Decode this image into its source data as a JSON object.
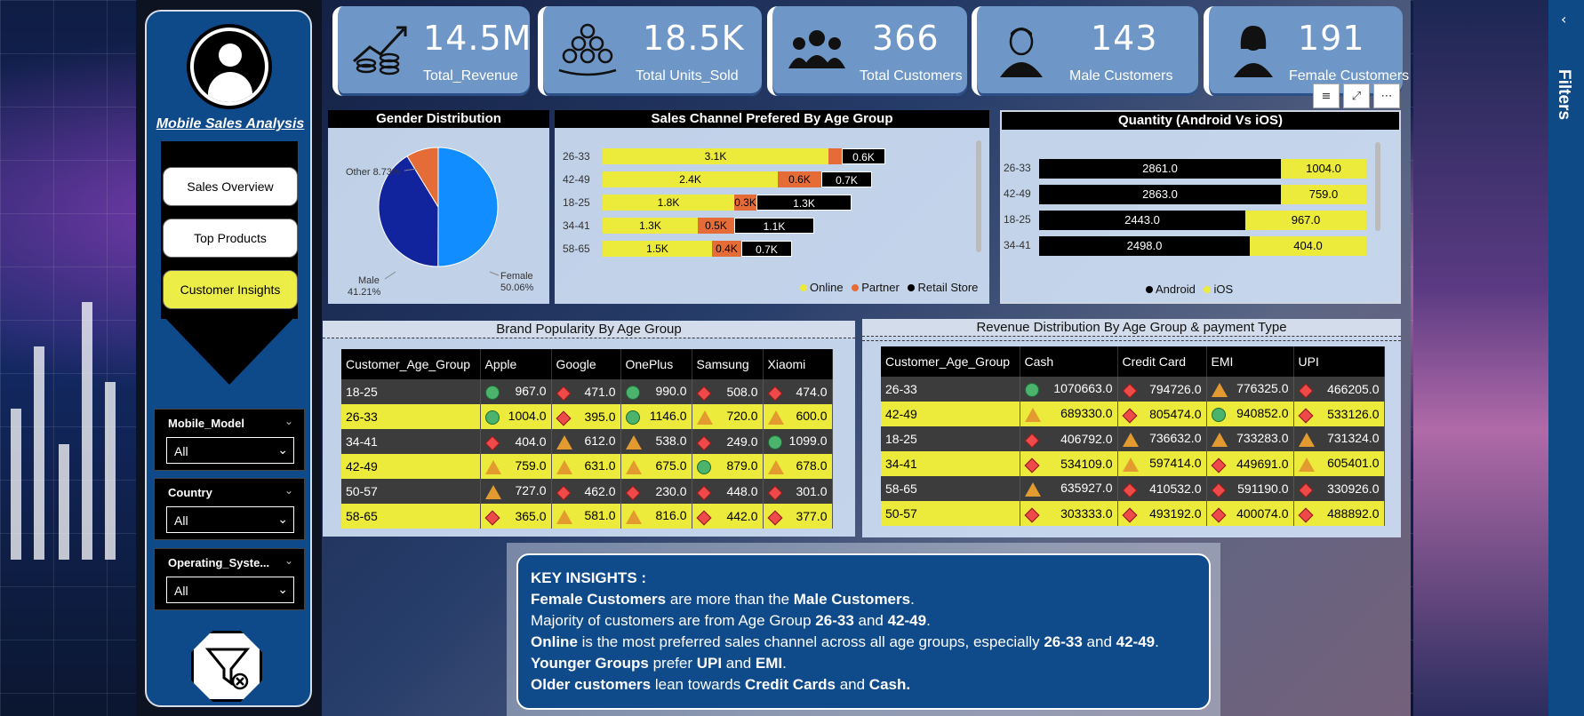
{
  "sidebar": {
    "title": "Mobile Sales Analysis",
    "nav": [
      {
        "label": "Sales Overview",
        "active": false
      },
      {
        "label": "Top Products",
        "active": false
      },
      {
        "label": "Customer Insights",
        "active": true
      }
    ],
    "slicers": [
      {
        "title": "Mobile_Model",
        "value": "All"
      },
      {
        "title": "Country",
        "value": "All"
      },
      {
        "title": "Operating_Syste...",
        "value": "All"
      }
    ]
  },
  "kpis": [
    {
      "value": "14.5M",
      "label": "Total_Revenue",
      "icon": "revenue-chart-icon"
    },
    {
      "value": "18.5K",
      "label": "Total Units_Sold",
      "icon": "coins-stack-icon"
    },
    {
      "value": "366",
      "label": "Total Customers",
      "icon": "customers-group-icon"
    },
    {
      "value": "143",
      "label": "Male Customers",
      "icon": "male-user-icon"
    },
    {
      "value": "191",
      "label": "Female Customers",
      "icon": "female-user-icon"
    }
  ],
  "gender": {
    "title": "Gender Distribution",
    "slices": [
      {
        "name": "Female",
        "pct": "50.06%",
        "value": 50.06,
        "color": "#118dff"
      },
      {
        "name": "Male",
        "pct": "41.21%",
        "value": 41.21,
        "color": "#12239e"
      },
      {
        "name": "Other",
        "pct": "8.73%",
        "value": 8.73,
        "color": "#e66c37"
      }
    ]
  },
  "channel": {
    "title": "Sales Channel Prefered By Age Group",
    "legend": [
      "Online",
      "Partner",
      "Retail Store"
    ],
    "colors": [
      "#ecea3a",
      "#e66c37",
      "#000000"
    ],
    "rows": [
      {
        "age": "26-33",
        "labels": [
          "3.1K",
          "",
          "0.6K"
        ],
        "values": [
          3.1,
          0.18,
          0.6
        ]
      },
      {
        "age": "42-49",
        "labels": [
          "2.4K",
          "0.6K",
          "0.7K"
        ],
        "values": [
          2.4,
          0.6,
          0.7
        ]
      },
      {
        "age": "18-25",
        "labels": [
          "1.8K",
          "0.3K",
          "1.3K"
        ],
        "values": [
          1.8,
          0.3,
          1.3
        ]
      },
      {
        "age": "34-41",
        "labels": [
          "1.3K",
          "0.5K",
          "1.1K"
        ],
        "values": [
          1.3,
          0.5,
          1.1
        ]
      },
      {
        "age": "58-65",
        "labels": [
          "1.5K",
          "0.4K",
          "0.7K"
        ],
        "values": [
          1.5,
          0.4,
          0.7
        ]
      }
    ]
  },
  "quantity": {
    "title": "Quantity (Android Vs iOS)",
    "legend": [
      "Android",
      "iOS"
    ],
    "rows": [
      {
        "age": "26-33",
        "android": "2861.0",
        "ios": "1004.0"
      },
      {
        "age": "42-49",
        "android": "2863.0",
        "ios": "759.0"
      },
      {
        "age": "18-25",
        "android": "2443.0",
        "ios": "967.0"
      },
      {
        "age": "34-41",
        "android": "2498.0",
        "ios": "404.0"
      }
    ]
  },
  "brand": {
    "title": "Brand Popularity By Age Group",
    "headers": [
      "Customer_Age_Group",
      "Apple",
      "Google",
      "OnePlus",
      "Samsung",
      "Xiaomi"
    ],
    "rows": [
      {
        "age": "18-25",
        "cells": [
          [
            "circle",
            "967.0"
          ],
          [
            "diamond",
            "471.0"
          ],
          [
            "circle",
            "990.0"
          ],
          [
            "diamond",
            "508.0"
          ],
          [
            "diamond",
            "474.0"
          ]
        ]
      },
      {
        "age": "26-33",
        "cells": [
          [
            "circle",
            "1004.0"
          ],
          [
            "diamond",
            "395.0"
          ],
          [
            "circle",
            "1146.0"
          ],
          [
            "triangle",
            "720.0"
          ],
          [
            "triangle",
            "600.0"
          ]
        ]
      },
      {
        "age": "34-41",
        "cells": [
          [
            "diamond",
            "404.0"
          ],
          [
            "triangle",
            "612.0"
          ],
          [
            "triangle",
            "538.0"
          ],
          [
            "diamond",
            "249.0"
          ],
          [
            "circle",
            "1099.0"
          ]
        ]
      },
      {
        "age": "42-49",
        "cells": [
          [
            "triangle",
            "759.0"
          ],
          [
            "triangle",
            "631.0"
          ],
          [
            "triangle",
            "675.0"
          ],
          [
            "circle",
            "879.0"
          ],
          [
            "triangle",
            "678.0"
          ]
        ]
      },
      {
        "age": "50-57",
        "cells": [
          [
            "triangle",
            "727.0"
          ],
          [
            "diamond",
            "462.0"
          ],
          [
            "diamond",
            "230.0"
          ],
          [
            "diamond",
            "448.0"
          ],
          [
            "diamond",
            "301.0"
          ]
        ]
      },
      {
        "age": "58-65",
        "cells": [
          [
            "diamond",
            "365.0"
          ],
          [
            "triangle",
            "581.0"
          ],
          [
            "triangle",
            "816.0"
          ],
          [
            "diamond",
            "442.0"
          ],
          [
            "diamond",
            "377.0"
          ]
        ]
      }
    ]
  },
  "revenue": {
    "title": "Revenue Distribution By Age Group & payment Type",
    "headers": [
      "Customer_Age_Group",
      "Cash",
      "Credit Card",
      "EMI",
      "UPI"
    ],
    "rows": [
      {
        "age": "26-33",
        "cells": [
          [
            "circle",
            "1070663.0"
          ],
          [
            "diamond",
            "794726.0"
          ],
          [
            "triangle",
            "776325.0"
          ],
          [
            "diamond",
            "466205.0"
          ]
        ]
      },
      {
        "age": "42-49",
        "cells": [
          [
            "triangle",
            "689330.0"
          ],
          [
            "diamond",
            "805474.0"
          ],
          [
            "circle",
            "940852.0"
          ],
          [
            "diamond",
            "533126.0"
          ]
        ]
      },
      {
        "age": "18-25",
        "cells": [
          [
            "diamond",
            "406792.0"
          ],
          [
            "triangle",
            "736632.0"
          ],
          [
            "triangle",
            "733283.0"
          ],
          [
            "triangle",
            "731324.0"
          ]
        ]
      },
      {
        "age": "34-41",
        "cells": [
          [
            "diamond",
            "534109.0"
          ],
          [
            "triangle",
            "597414.0"
          ],
          [
            "diamond",
            "449691.0"
          ],
          [
            "triangle",
            "605401.0"
          ]
        ]
      },
      {
        "age": "58-65",
        "cells": [
          [
            "triangle",
            "635927.0"
          ],
          [
            "diamond",
            "410532.0"
          ],
          [
            "diamond",
            "591190.0"
          ],
          [
            "diamond",
            "330926.0"
          ]
        ]
      },
      {
        "age": "50-57",
        "cells": [
          [
            "diamond",
            "303333.0"
          ],
          [
            "diamond",
            "493192.0"
          ],
          [
            "diamond",
            "400074.0"
          ],
          [
            "diamond",
            "488892.0"
          ]
        ]
      }
    ]
  },
  "insights": {
    "heading": "KEY INSIGHTS :",
    "lines": [
      [
        [
          "b",
          "Female Customers"
        ],
        [
          "t",
          " are more than the "
        ],
        [
          "b",
          "Male Customers"
        ],
        [
          "t",
          "."
        ]
      ],
      [
        [
          "t",
          "Majority of customers are from Age Group "
        ],
        [
          "b",
          "26-33"
        ],
        [
          "t",
          " and "
        ],
        [
          "b",
          "42-49"
        ],
        [
          "t",
          "."
        ]
      ],
      [
        [
          "b",
          "Online"
        ],
        [
          "t",
          " is the most preferred sales channel across all age groups, especially "
        ],
        [
          "b",
          "26-33"
        ],
        [
          "t",
          " and "
        ],
        [
          "b",
          "42-49"
        ],
        [
          "t",
          "."
        ]
      ],
      [
        [
          "b",
          "Younger Groups"
        ],
        [
          "t",
          " prefer "
        ],
        [
          "b",
          "UPI"
        ],
        [
          "t",
          " and "
        ],
        [
          "b",
          "EMI"
        ],
        [
          "t",
          "."
        ]
      ],
      [
        [
          "b",
          "Older customers"
        ],
        [
          "t",
          " lean towards "
        ],
        [
          "b",
          "Credit Cards"
        ],
        [
          "t",
          " and "
        ],
        [
          "b",
          "Cash."
        ]
      ]
    ]
  },
  "filters_pane": {
    "label": "Filters"
  }
}
